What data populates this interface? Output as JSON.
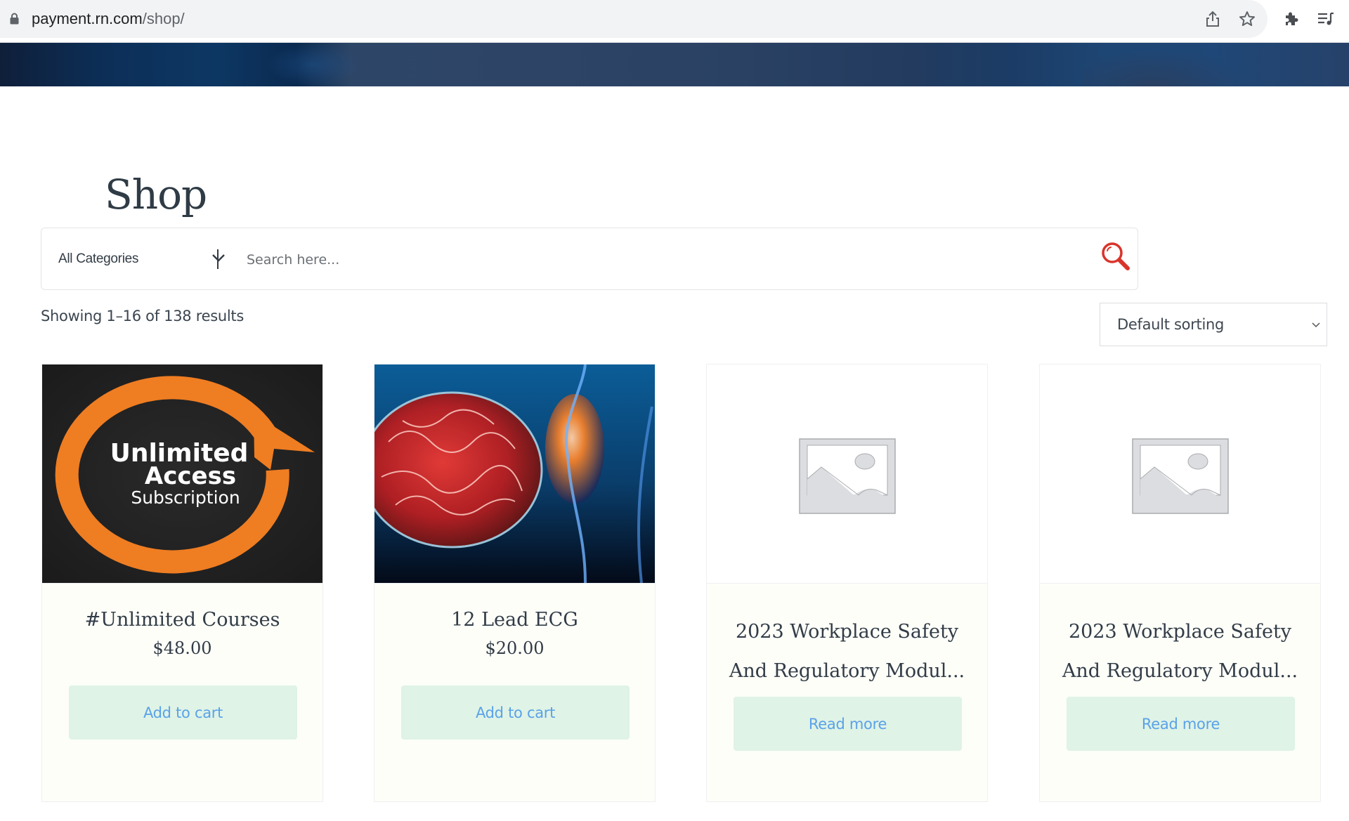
{
  "browser": {
    "url_host": "payment.rn.com",
    "url_path": "/shop/",
    "icons": [
      "lock-icon",
      "share-icon",
      "bookmark-star-icon",
      "extensions-icon",
      "reading-list-icon"
    ]
  },
  "page": {
    "title": "Shop"
  },
  "search": {
    "category_label": "All Categories",
    "placeholder": "Search here...",
    "value": ""
  },
  "results": {
    "count_text": "Showing 1–16 of 138 results"
  },
  "sort": {
    "selected": "Default sorting"
  },
  "products": [
    {
      "title": "#Unlimited Courses",
      "price": "$48.00",
      "button": "Add to cart",
      "image": "unlimited-access-subscription",
      "image_text": [
        "Unlimited",
        "Access",
        "Subscription"
      ]
    },
    {
      "title": "12 Lead ECG",
      "price": "$20.00",
      "button": "Add to cart",
      "image": "blood-clot-illustration"
    },
    {
      "title_lines": [
        "2023 Workplace Safety",
        "And Regulatory Modul..."
      ],
      "button": "Read more",
      "image": "placeholder"
    },
    {
      "title_lines": [
        "2023 Workplace Safety",
        "And Regulatory Modul..."
      ],
      "button": "Read more",
      "image": "placeholder"
    }
  ],
  "colors": {
    "search_icon": "#d9342b",
    "button_bg": "#dff3e6",
    "button_text": "#5aa2e8",
    "card_bg": "#fdfef8",
    "banner": "#1e3c64",
    "orange": "#ef7d22"
  }
}
